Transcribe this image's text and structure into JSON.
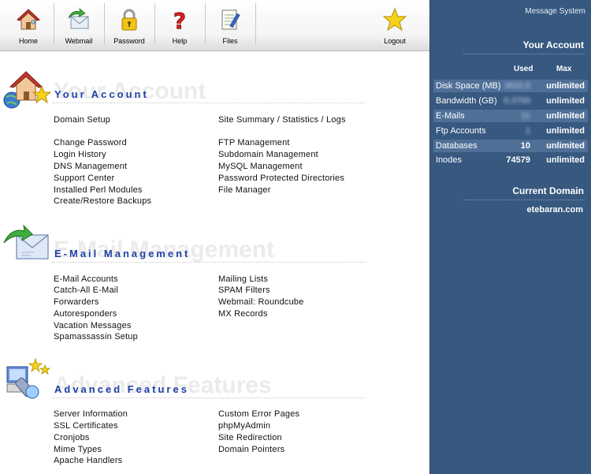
{
  "toolbar": {
    "home": "Home",
    "webmail": "Webmail",
    "password": "Password",
    "help": "Help",
    "files": "Files",
    "logout": "Logout"
  },
  "sections": {
    "account": {
      "title": "Your Account",
      "ghost": "Your Account",
      "left": [
        "Domain Setup",
        "Change Password",
        "Login History",
        "DNS Management",
        "Support Center",
        "Installed Perl Modules",
        "Create/Restore Backups"
      ],
      "right": [
        "Site Summary / Statistics / Logs",
        "FTP Management",
        "Subdomain Management",
        "MySQL Management",
        "Password Protected Directories",
        "File Manager"
      ]
    },
    "email": {
      "title": "E-Mail Management",
      "ghost": "E-Mail Management",
      "left": [
        "E-Mail Accounts",
        "Catch-All E-Mail",
        "Forwarders",
        "Autoresponders",
        "Vacation Messages",
        "Spamassassin Setup"
      ],
      "right": [
        "Mailing Lists",
        "SPAM Filters",
        "Webmail: Roundcube",
        "MX Records"
      ]
    },
    "advanced": {
      "title": "Advanced Features",
      "ghost": "Advanced Features",
      "left": [
        "Server Information",
        "SSL Certificates",
        "Cronjobs",
        "Mime Types",
        "Apache Handlers"
      ],
      "right": [
        "Custom Error Pages",
        "phpMyAdmin",
        "Site Redirection",
        "Domain Pointers"
      ]
    }
  },
  "sidebar": {
    "message_system": "Message System",
    "your_account": "Your Account",
    "col_used": "Used",
    "col_max": "Max",
    "stats": [
      {
        "name": "Disk Space (MB)",
        "used": "3832.5",
        "max": "unlimited",
        "blurred": true
      },
      {
        "name": "Bandwidth (GB)",
        "used": "0.3750",
        "max": "unlimited",
        "blurred": true
      },
      {
        "name": "E-Mails",
        "used": "11",
        "max": "unlimited",
        "blurred": true
      },
      {
        "name": "Ftp Accounts",
        "used": "1",
        "max": "unlimited",
        "blurred": true
      },
      {
        "name": "Databases",
        "used": "10",
        "max": "unlimited",
        "blurred": false
      },
      {
        "name": "Inodes",
        "used": "74579",
        "max": "unlimited",
        "blurred": false
      }
    ],
    "current_domain_label": "Current Domain",
    "current_domain": "etebaran.com"
  },
  "colors": {
    "sidebar_bg": "#37587f",
    "sidebar_row_shade": "#4f6f97",
    "section_title": "#1f3fa8"
  },
  "icons": {
    "home": "house-icon",
    "webmail": "envelope-arrow-icon",
    "password": "padlock-icon",
    "help": "question-mark-icon",
    "files": "notepad-pen-icon",
    "logout": "star-icon"
  }
}
